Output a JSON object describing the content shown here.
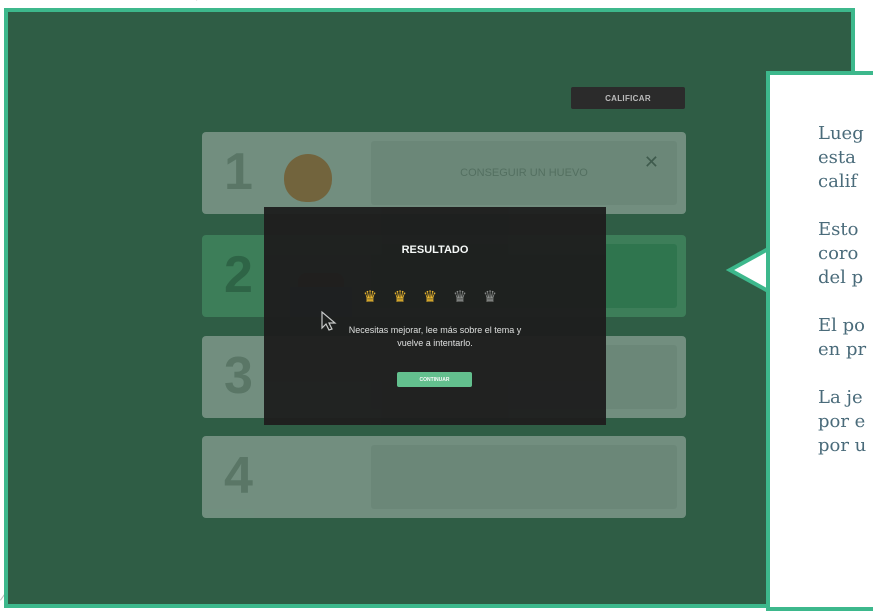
{
  "toolbar": {
    "grade_label": "CALIFICAR"
  },
  "steps": [
    {
      "number": "1",
      "label": "CONSEGUIR UN HUEVO"
    },
    {
      "number": "2",
      "label": ""
    },
    {
      "number": "3",
      "label": ""
    },
    {
      "number": "4",
      "label": ""
    }
  ],
  "modal": {
    "title": "RESULTADO",
    "stars_earned": 3,
    "stars_total": 5,
    "message_line1": "Necesitas mejorar, lee más sobre el tema y",
    "message_line2": "vuelve a intentarlo.",
    "continue_label": "CONTINUAR"
  },
  "callout": {
    "lines": [
      "Lueg",
      "esta",
      "calif",
      "",
      "Esto",
      "coro",
      "del p",
      "",
      "El po",
      "en pr",
      "",
      "La je",
      "por e",
      "por u"
    ]
  },
  "colors": {
    "accent": "#3db88c",
    "background": "#2f5d45",
    "crown_gold": "#f0b92e",
    "button": "#63c38f"
  }
}
